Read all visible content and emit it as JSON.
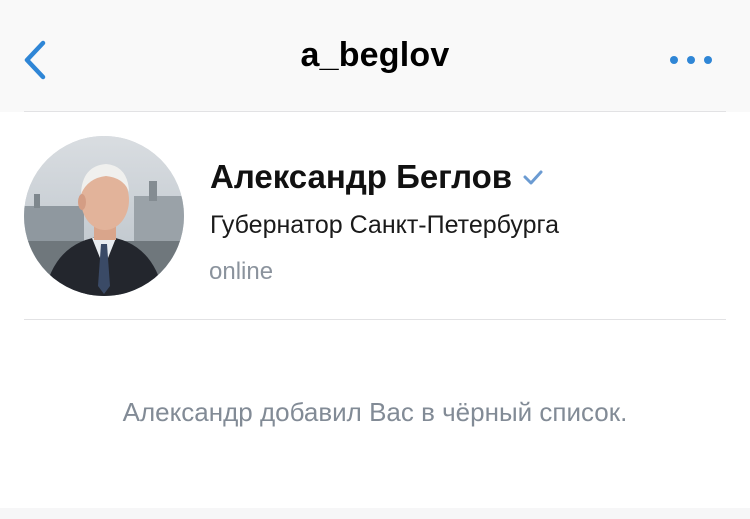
{
  "header": {
    "title": "a_beglov",
    "back_icon": "chevron-left-icon",
    "more_icon": "ellipsis-icon"
  },
  "profile": {
    "name": "Александр Беглов",
    "status": "Губернатор Санкт-Петербурга",
    "online": "online",
    "verified_icon": "checkmark-icon"
  },
  "message": {
    "text": "Александр добавил Вас в чёрный список."
  },
  "colors": {
    "accent": "#2f86d6",
    "muted_text": "#828b96",
    "background": "#ffffff",
    "header_background": "#f9f9f9"
  }
}
